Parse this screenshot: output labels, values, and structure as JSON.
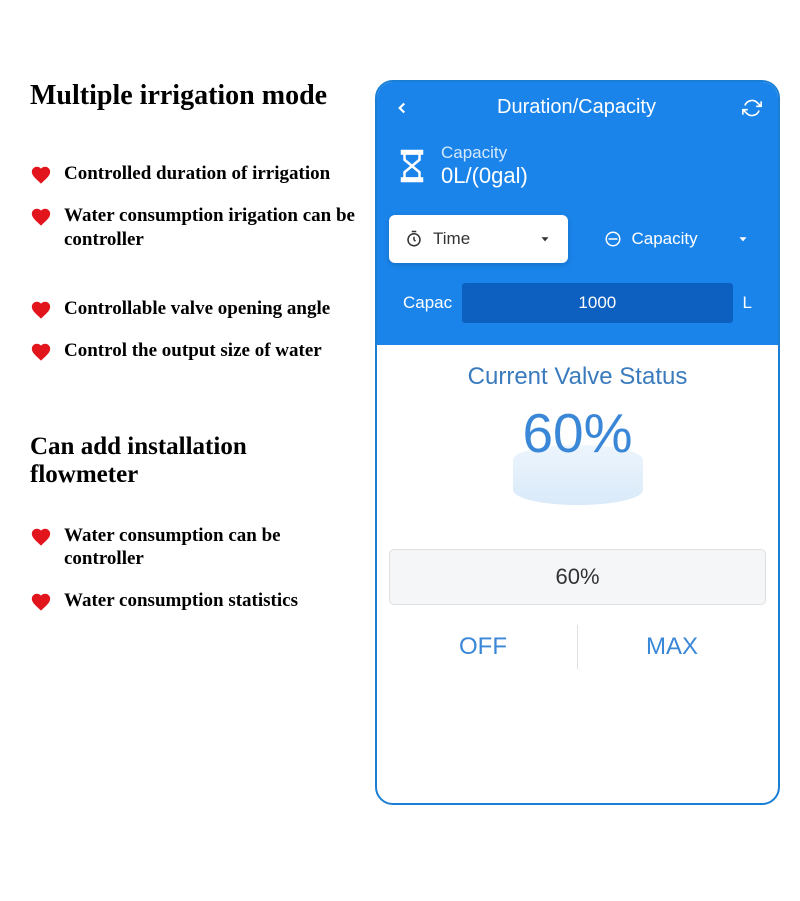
{
  "left": {
    "heading1": "Multiple irrigation mode",
    "features1": [
      "Controlled duration of irrigation",
      "Water consumption irigation can be controller"
    ],
    "features2": [
      "Controllable valve opening angle",
      "Control the output size of water"
    ],
    "heading2": "Can add installation flowmeter",
    "features3": [
      "Water consumption can be controller",
      "Water consumption statistics"
    ]
  },
  "phone": {
    "title": "Duration/Capacity",
    "capacity_label": "Capacity",
    "capacity_value": "0L/(0gal)",
    "tabs": {
      "time": "Time",
      "capacity": "Capacity"
    },
    "input_prefix": "Capac",
    "input_value": "1000",
    "input_suffix": "L",
    "valve_status_title": "Current Valve Status",
    "valve_percentage": "60%",
    "slider_value": "60%",
    "off_label": "OFF",
    "max_label": "MAX"
  }
}
